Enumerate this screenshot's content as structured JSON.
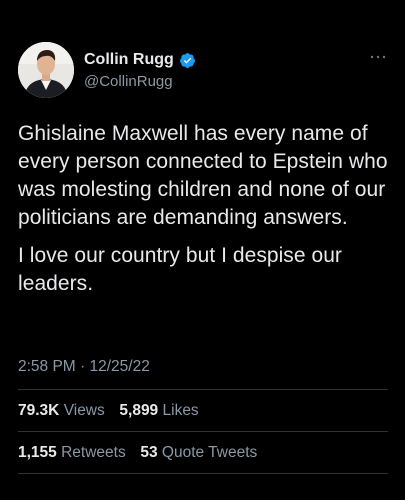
{
  "author": {
    "display_name": "Collin Rugg",
    "handle": "@CollinRugg",
    "verified": true,
    "verified_color": "#1d9bf0"
  },
  "tweet": {
    "paragraphs": [
      "Ghislaine Maxwell has every name of every person connected to Epstein who was molesting children and none of our politicians are demanding answers.",
      "I love our country but I despise our leaders."
    ],
    "timestamp": "2:58 PM · 12/25/22"
  },
  "stats": {
    "views_count": "79.3K",
    "views_label": "Views",
    "likes_count": "5,899",
    "likes_label": "Likes",
    "retweets_count": "1,155",
    "retweets_label": "Retweets",
    "quotes_count": "53",
    "quotes_label": "Quote Tweets"
  },
  "icons": {
    "avatar": "person-avatar",
    "verified": "verified-badge-icon",
    "more": "more-options-icon"
  },
  "colors": {
    "background": "#000000",
    "text_primary": "#e7e9ea",
    "text_secondary": "#8b98a5",
    "divider": "#2f3336"
  }
}
